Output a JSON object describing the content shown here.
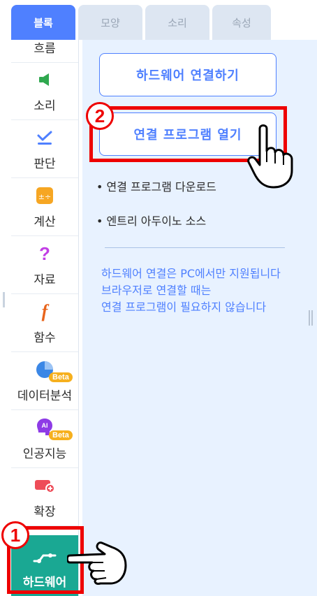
{
  "tabs": [
    {
      "label": "블록",
      "active": true
    },
    {
      "label": "모양",
      "active": false
    },
    {
      "label": "소리",
      "active": false
    },
    {
      "label": "속성",
      "active": false
    }
  ],
  "categories": [
    {
      "label": "흐름",
      "icon": "flow-icon"
    },
    {
      "label": "소리",
      "icon": "speaker-icon",
      "color": "#2fa84f"
    },
    {
      "label": "판단",
      "icon": "check-icon",
      "color": "#4f80ff"
    },
    {
      "label": "계산",
      "icon": "calculator-icon",
      "color": "#f6a623"
    },
    {
      "label": "자료",
      "icon": "question-icon",
      "color": "#c23ee5"
    },
    {
      "label": "함수",
      "icon": "function-icon",
      "color": "#e8641b"
    },
    {
      "label": "데이터분석",
      "icon": "pie-chart-icon",
      "color": "#3b87e6",
      "badge": "Beta"
    },
    {
      "label": "인공지능",
      "icon": "ai-icon",
      "color": "#8e3be6",
      "badge": "Beta"
    },
    {
      "label": "확장",
      "icon": "extension-icon",
      "color": "#ee4c58"
    },
    {
      "label": "하드웨어",
      "icon": "hardware-icon",
      "color": "#1aa893"
    }
  ],
  "panel": {
    "connect_button": "하드웨어 연결하기",
    "open_program_button": "연결 프로그램 열기",
    "links": [
      "연결 프로그램 다운로드",
      "엔트리 아두이노 소스"
    ],
    "info_lines": [
      "하드웨어 연결은 PC에서만 지원됩니다",
      "브라우저로 연결할 때는",
      "연결 프로그램이 필요하지 않습니다"
    ]
  },
  "annotations": {
    "step1": "1",
    "step2": "2",
    "highlight_color": "#ee0000"
  },
  "colors": {
    "accent": "#4f80ff",
    "hardware": "#1aa893",
    "panel_bg": "#e8f2ff"
  }
}
